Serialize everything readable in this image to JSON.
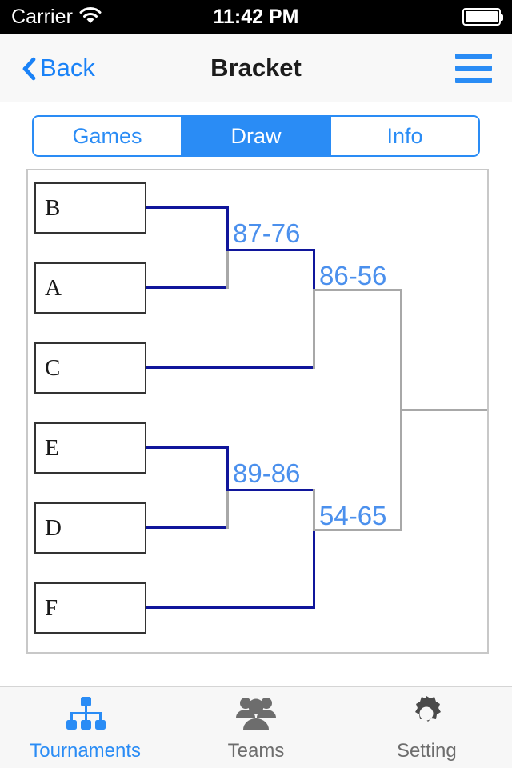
{
  "status_bar": {
    "carrier": "Carrier",
    "wifi_icon": "wifi-icon",
    "time": "11:42 PM",
    "battery_icon": "battery-full-icon"
  },
  "nav_bar": {
    "back_label": "Back",
    "back_icon": "chevron-left-icon",
    "title": "Bracket",
    "menu_icon": "hamburger-menu-icon"
  },
  "segmented_control": {
    "selected": "Draw",
    "segments": [
      {
        "label": "Games",
        "active": false
      },
      {
        "label": "Draw",
        "active": true
      },
      {
        "label": "Info",
        "active": false
      }
    ]
  },
  "bracket": {
    "teams": [
      {
        "label": "B"
      },
      {
        "label": "A"
      },
      {
        "label": "C"
      },
      {
        "label": "E"
      },
      {
        "label": "D"
      },
      {
        "label": "F"
      }
    ],
    "matches": [
      {
        "teams": "B vs A",
        "score": "87-76",
        "round": 1
      },
      {
        "teams": "winner(B/A) vs C",
        "score": "86-56",
        "round": 2
      },
      {
        "teams": "E vs D",
        "score": "89-86",
        "round": 1
      },
      {
        "teams": "winner(E/D) vs F",
        "score": "54-65",
        "round": 2
      }
    ],
    "scores": [
      "87-76",
      "86-56",
      "89-86",
      "54-65"
    ],
    "line_color": "#10169b",
    "pending_line_color": "#a8a8a8",
    "score_color": "#4b90ed"
  },
  "tab_bar": {
    "tabs": [
      {
        "label": "Tournaments",
        "icon": "org-chart-icon",
        "active": true
      },
      {
        "label": "Teams",
        "icon": "people-icon",
        "active": false
      },
      {
        "label": "Setting",
        "icon": "gear-icon",
        "active": false
      }
    ]
  }
}
